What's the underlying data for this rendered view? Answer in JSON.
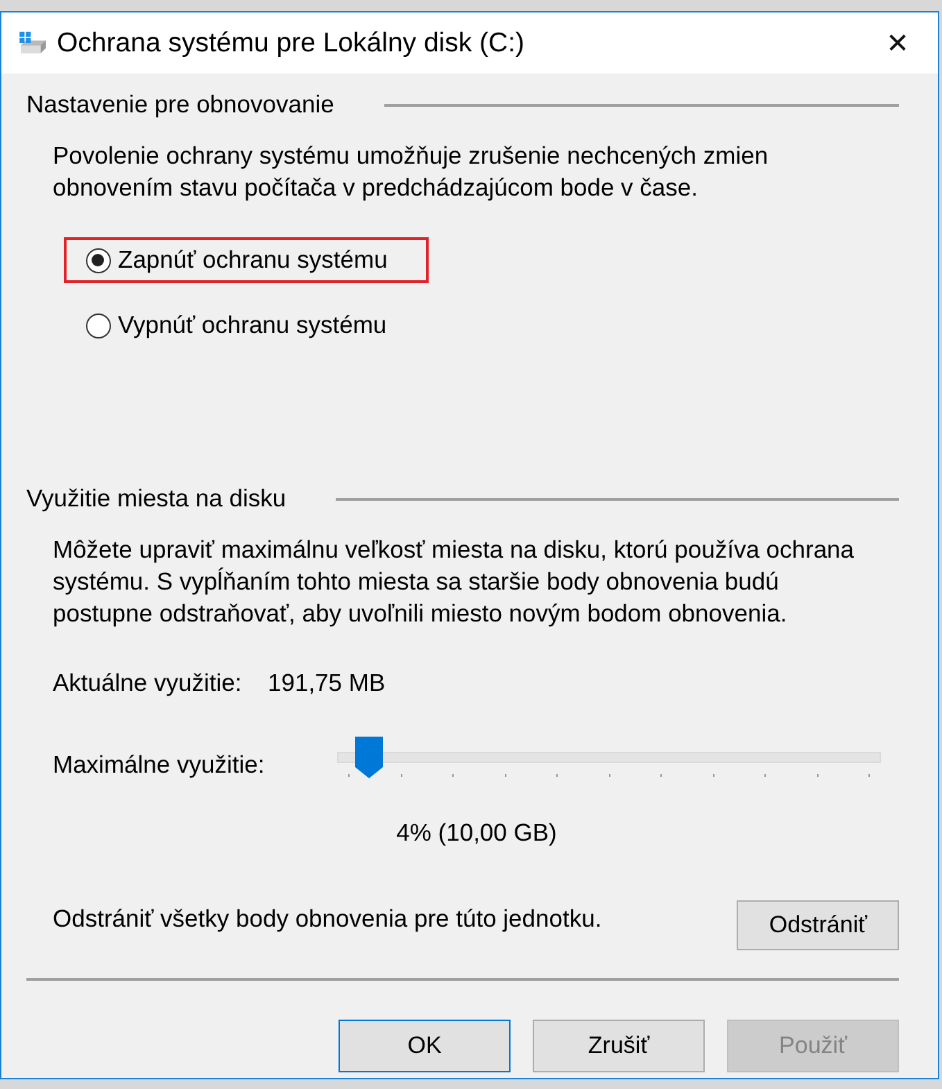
{
  "window": {
    "title": "Ochrana systému pre Lokálny disk (C:)",
    "close": "✕"
  },
  "restore_settings": {
    "heading": "Nastavenie pre obnovovanie",
    "description": "Povolenie ochrany systému umožňuje zrušenie nechcených zmien obnovením stavu počítača v predchádzajúcom bode v čase.",
    "options": [
      {
        "label": "Zapnúť ochranu systému",
        "selected": true,
        "highlighted": true
      },
      {
        "label": "Vypnúť ochranu systému",
        "selected": false,
        "highlighted": false
      }
    ]
  },
  "disk_usage": {
    "heading": "Využitie miesta na disku",
    "description": "Môžete upraviť maximálnu veľkosť miesta na disku, ktorú používa ochrana systému. S vypĺňaním tohto miesta sa staršie body obnovenia budú postupne odstraňovať, aby uvoľnili miesto novým bodom obnovenia.",
    "current_label": "Aktuálne využitie:",
    "current_value": "191,75 MB",
    "max_label": "Maximálne využitie:",
    "slider": {
      "level": 0.04
    },
    "slider_reading": "4% (10,00 GB)",
    "delete_text": "Odstrániť všetky body obnovenia pre túto jednotku.",
    "delete_button": "Odstrániť"
  },
  "buttons": [
    {
      "label": "OK",
      "kind": "default",
      "disabled": false
    },
    {
      "label": "Zrušiť",
      "kind": "normal",
      "disabled": false
    },
    {
      "label": "Použiť",
      "kind": "normal",
      "disabled": true
    }
  ]
}
